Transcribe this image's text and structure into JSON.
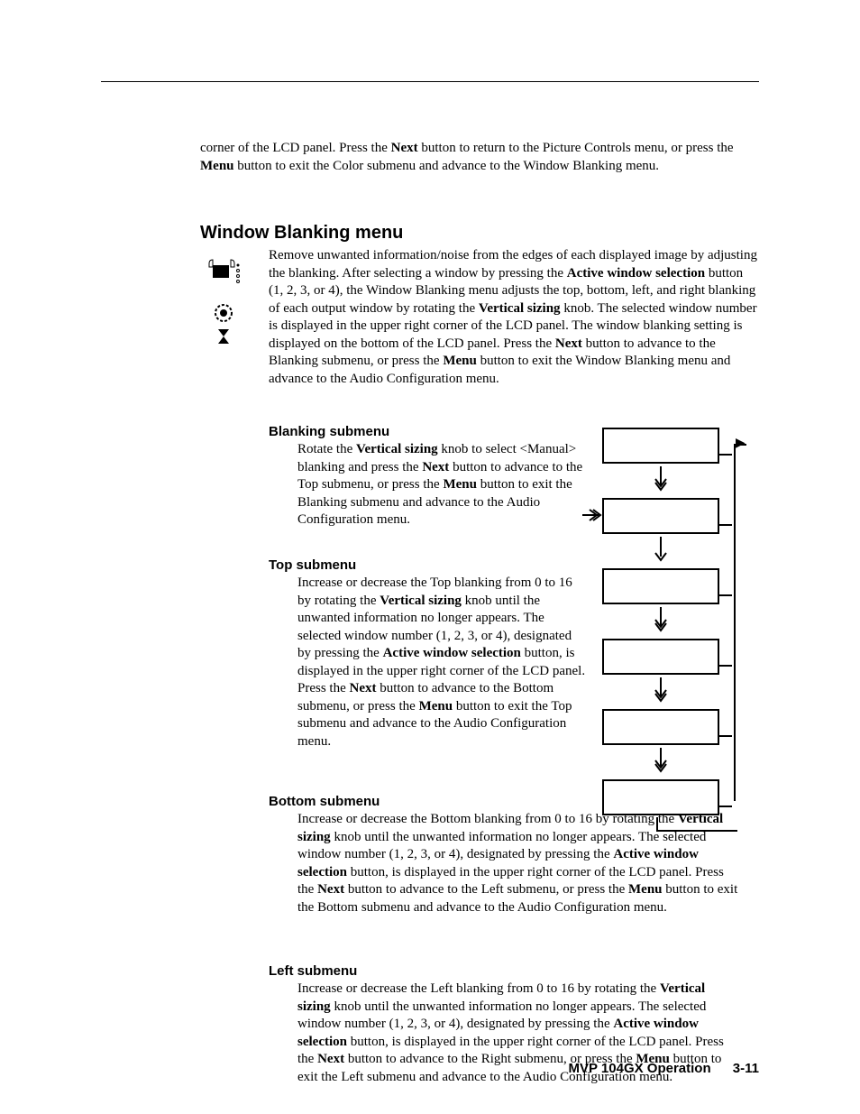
{
  "intro": {
    "p1_a": "corner of the LCD panel.  Press the ",
    "p1_b": "Next",
    "p1_c": " button to return to the Picture Controls menu, or press the ",
    "p1_d": "Menu",
    "p1_e": " button to exit the Color submenu and advance to the Window Blanking menu."
  },
  "heading_main": "Window Blanking menu",
  "main": {
    "a": "Remove unwanted information/noise from the edges of each displayed image by adjusting the blanking.  After selecting a window by pressing the ",
    "b": "Active window selection",
    "c": " button (1, 2, 3, or 4), the Window Blanking menu adjusts the top, bottom, left, and right blanking of each output window by rotating the ",
    "d": "Vertical sizing",
    "e": " knob.  The selected window number is displayed in the upper right corner of the LCD panel.  The window blanking setting is displayed on the bottom of the LCD panel. Press the ",
    "f": "Next",
    "g": " button to advance to the Blanking submenu, or press the ",
    "h": "Menu",
    "i": " button to exit the Window Blanking menu and advance to the Audio Configuration menu."
  },
  "sub1": {
    "title": "Blanking submenu",
    "a": "Rotate the ",
    "b": "Vertical sizing",
    "c": " knob to select <Manual> blanking and press the ",
    "d": "Next",
    "e": " button to advance to the Top submenu, or press the ",
    "f": "Menu",
    "g": " button to exit the Blanking submenu and advance to the Audio Configuration menu."
  },
  "sub2": {
    "title": "Top submenu",
    "a": "Increase or decrease the Top blanking from 0 to 16 by rotating the ",
    "b": "Vertical sizing",
    "c": " knob until the unwanted information no longer appears.  The selected window number (1, 2, 3, or 4), designated by pressing the ",
    "d": "Active window selection",
    "e": " button, is displayed in the upper right corner of the LCD panel.  Press the ",
    "f": "Next",
    "g": " button to advance to the Bottom submenu, or press the ",
    "h": "Menu",
    "i": " button to exit the Top submenu and advance to the Audio Configuration menu."
  },
  "sub3": {
    "title": "Bottom submenu",
    "a": "Increase or decrease the Bottom blanking from 0 to 16 by rotating the ",
    "b": "Vertical sizing",
    "c": " knob until the unwanted information no longer appears.  The selected window number (1, 2, 3, or 4), designated by pressing the ",
    "d": "Active window selection",
    "e": " button, is displayed in the upper right corner of the LCD panel.  Press the ",
    "f": "Next",
    "g": " button to advance to the Left submenu, or press the ",
    "h": "Menu",
    "i": " button to exit the Bottom submenu and advance to the Audio Configuration menu."
  },
  "sub4": {
    "title": "Left submenu",
    "a": "Increase or decrease the Left blanking from 0 to 16 by rotating the ",
    "b": "Vertical sizing",
    "c": " knob until the unwanted information no longer appears.  The selected window number (1, 2, 3, or 4), designated by pressing the ",
    "d": "Active window selection",
    "e": " button, is displayed in the upper right corner of the LCD panel.  Press the ",
    "f": "Next",
    "g": " button to advance to the Right submenu, or press the ",
    "h": "Menu",
    "i": " button to exit the Left submenu and advance to the Audio Configuration menu."
  },
  "footer": {
    "title": "MVP 104GX Operation",
    "page": "3-11"
  },
  "icons": {
    "lcdpanel": "lcd-panel-icon",
    "knob": "knob-icon",
    "hourglass": "hourglass-icon"
  }
}
